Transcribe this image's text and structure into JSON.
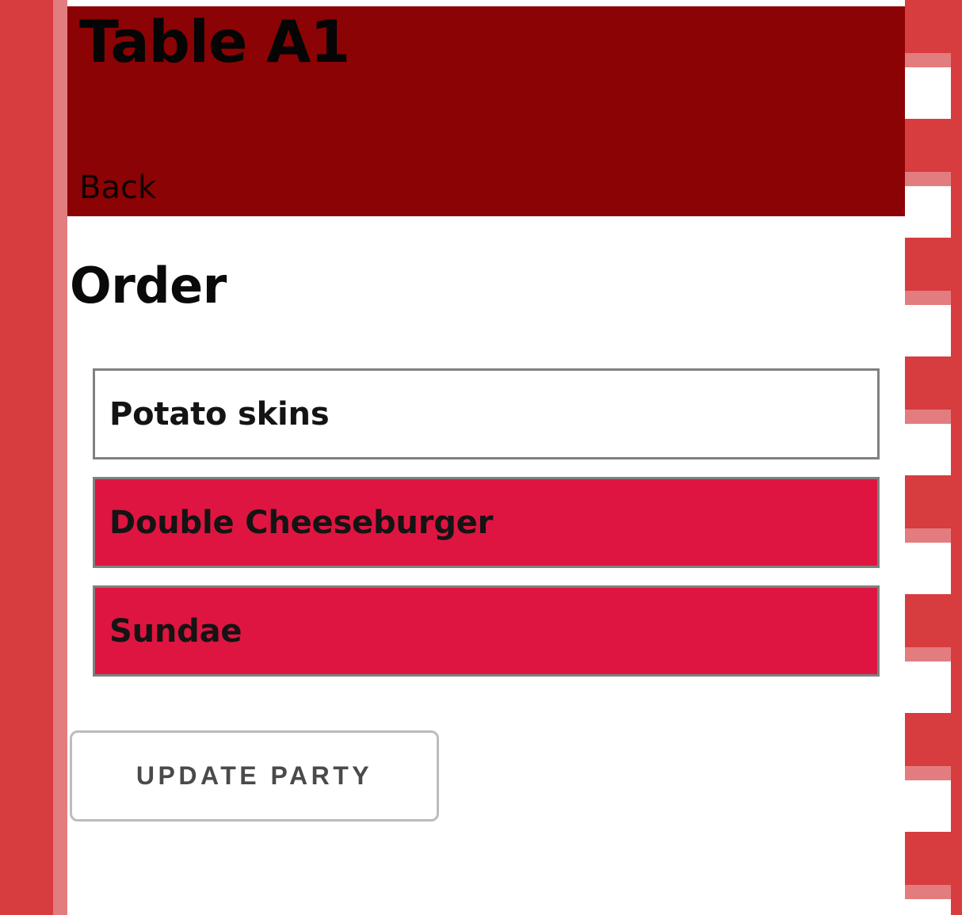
{
  "app": {
    "background_pattern": "red-white-checkered-tablecloth",
    "colors": {
      "header_band": "#8B0304",
      "selected_item": "#DE1540",
      "check_dark": "#D73C3E",
      "check_light": "#E37C7E",
      "item_border": "#808080",
      "button_border": "#BCBCBC",
      "button_text": "#4A4A4A"
    }
  },
  "header": {
    "title": "Table A1",
    "back_label": "Back"
  },
  "main": {
    "section_heading": "Order",
    "order_items": [
      {
        "label": "Potato skins",
        "selected": false
      },
      {
        "label": "Double Cheeseburger",
        "selected": true
      },
      {
        "label": "Sundae",
        "selected": true
      }
    ],
    "update_party_label": "UPDATE PARTY"
  }
}
